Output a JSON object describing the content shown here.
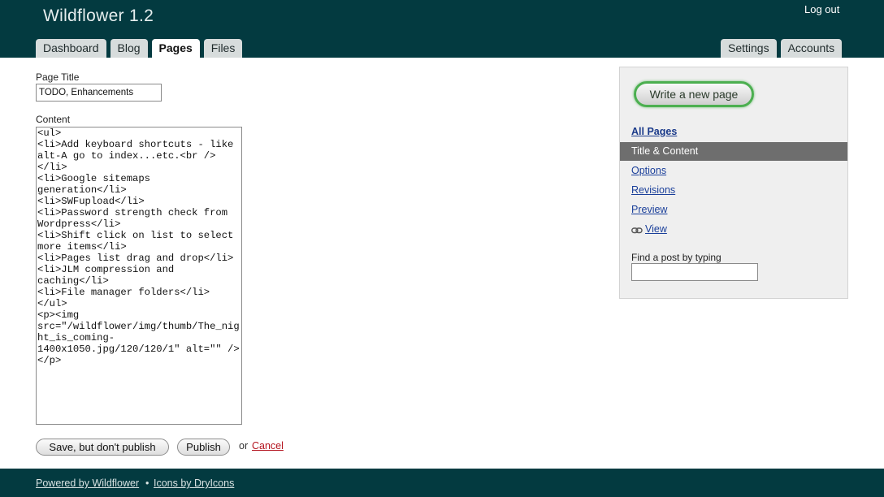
{
  "header": {
    "title": "Wildflower 1.2",
    "logout_label": "Log out",
    "tabs_left": [
      "Dashboard",
      "Blog",
      "Pages",
      "Files"
    ],
    "active_tab": "Pages",
    "tabs_right": [
      "Settings",
      "Accounts"
    ]
  },
  "form": {
    "title_label": "Page Title",
    "title_value": "TODO, Enhancements",
    "content_label": "Content",
    "content_value": "<ul>\n<li>Add keyboard shortcuts - like alt-A go to index...etc.<br /></li>\n<li>Google sitemaps generation</li>\n<li>SWFupload</li>\n<li>Password strength check from Wordpress</li>\n<li>Shift click on list to select more items</li>\n<li>Pages list drag and drop</li>\n<li>JLM compression and caching</li>\n<li>File manager folders</li>\n</ul>\n<p><img src=\"/wildflower/img/thumb/The_night_is_coming-1400x1050.jpg/120/120/1\" alt=\"\" /></p>",
    "save_draft_label": "Save, but don't publish",
    "publish_label": "Publish",
    "or_text": "or",
    "cancel_label": "Cancel"
  },
  "sidebar": {
    "write_button_label": "Write a new page",
    "all_pages_label": "All Pages",
    "active_item_label": "Title & Content",
    "options_label": "Options",
    "revisions_label": "Revisions",
    "preview_label": "Preview",
    "view_label": "View",
    "view_icon": "link-chain-icon",
    "find_label": "Find a post by typing",
    "find_value": ""
  },
  "footer": {
    "powered_label": "Powered by Wildflower",
    "bullet": "•",
    "icons_label": "Icons by DryIcons"
  },
  "colors": {
    "header_bg": "#033a40",
    "active_sidebar_bg": "#6e6e6e",
    "write_button_border": "#4caf50",
    "cancel_link": "#b4141f"
  }
}
